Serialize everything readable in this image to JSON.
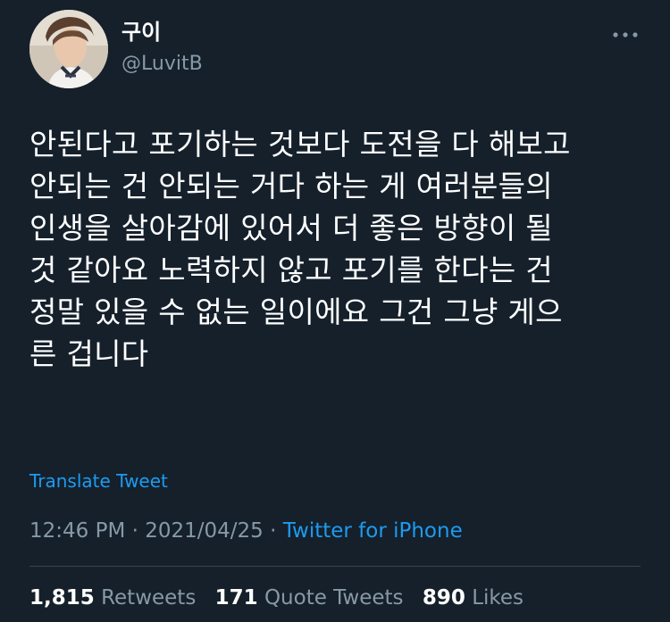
{
  "user": {
    "display_name": "구이",
    "handle": "@LuvitB"
  },
  "tweet": {
    "lines": [
      "안된다고 포기하는 것보다 도전을 다 해보고",
      "안되는 건 안되는 거다 하는 게 여러분들의",
      "인생을 살아감에 있어서 더 좋은 방향이 될",
      "것 같아요 노력하지 않고 포기를 한다는 건",
      "정말 있을 수 없는 일이에요 그건 그냥 게으",
      "른 겁니다"
    ],
    "translate_label": "Translate Tweet",
    "time": "12:46 PM",
    "separator": "·",
    "date": "2021/04/25",
    "source": "Twitter for iPhone"
  },
  "stats": {
    "retweets_count": "1,815",
    "retweets_label": "Retweets",
    "quote_count": "171",
    "quote_label": "Quote Tweets",
    "likes_count": "890",
    "likes_label": "Likes"
  },
  "icons": {
    "more": "more-horizontal-icon"
  },
  "colors": {
    "background": "#15202b",
    "link": "#1d9bf0",
    "secondary": "#8899a6",
    "divider": "#38444d"
  }
}
